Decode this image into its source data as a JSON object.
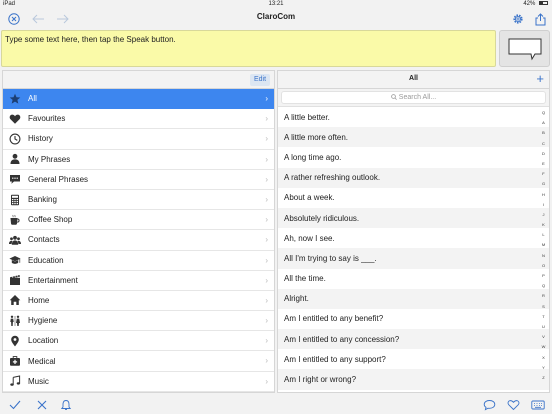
{
  "status": {
    "device": "iPad",
    "time": "13:21",
    "battery": "42%"
  },
  "nav": {
    "title": "ClaroCom"
  },
  "text_input": {
    "placeholder": "Type some text here, then tap the Speak button."
  },
  "categories_panel": {
    "edit_label": "Edit",
    "items": [
      {
        "label": "All",
        "icon": "star-icon"
      },
      {
        "label": "Favourites",
        "icon": "heart-icon"
      },
      {
        "label": "History",
        "icon": "clock-icon"
      },
      {
        "label": "My Phrases",
        "icon": "person-icon"
      },
      {
        "label": "General Phrases",
        "icon": "speech-bubble-icon"
      },
      {
        "label": "Banking",
        "icon": "calculator-icon"
      },
      {
        "label": "Coffee Shop",
        "icon": "coffee-cup-icon"
      },
      {
        "label": "Contacts",
        "icon": "people-icon"
      },
      {
        "label": "Education",
        "icon": "graduation-cap-icon"
      },
      {
        "label": "Entertainment",
        "icon": "film-icon"
      },
      {
        "label": "Home",
        "icon": "house-icon"
      },
      {
        "label": "Hygiene",
        "icon": "restroom-icon"
      },
      {
        "label": "Location",
        "icon": "map-pin-icon"
      },
      {
        "label": "Medical",
        "icon": "medical-box-icon"
      },
      {
        "label": "Music",
        "icon": "music-note-icon"
      }
    ]
  },
  "phrases_panel": {
    "title": "All",
    "search_placeholder": "Search All...",
    "phrases": [
      "A little better.",
      "A little more often.",
      "A long time ago.",
      "A rather refreshing outlook.",
      "About a week.",
      "Absolutely ridiculous.",
      "Ah, now I see.",
      "All I'm trying to say is ___.",
      "All the time.",
      "Alright.",
      "Am I entitled to any benefit?",
      "Am I entitled to any concession?",
      "Am I entitled to any support?",
      "Am I right or wrong?"
    ],
    "index_letters": [
      "Q",
      "A",
      "B",
      "C",
      "D",
      "E",
      "F",
      "G",
      "H",
      "I",
      "J",
      "K",
      "L",
      "M",
      "N",
      "O",
      "P",
      "Q",
      "R",
      "S",
      "T",
      "U",
      "V",
      "W",
      "X",
      "Y",
      "Z"
    ]
  },
  "colors": {
    "accent": "#3d86ef",
    "text_area": "#fafaa8"
  }
}
